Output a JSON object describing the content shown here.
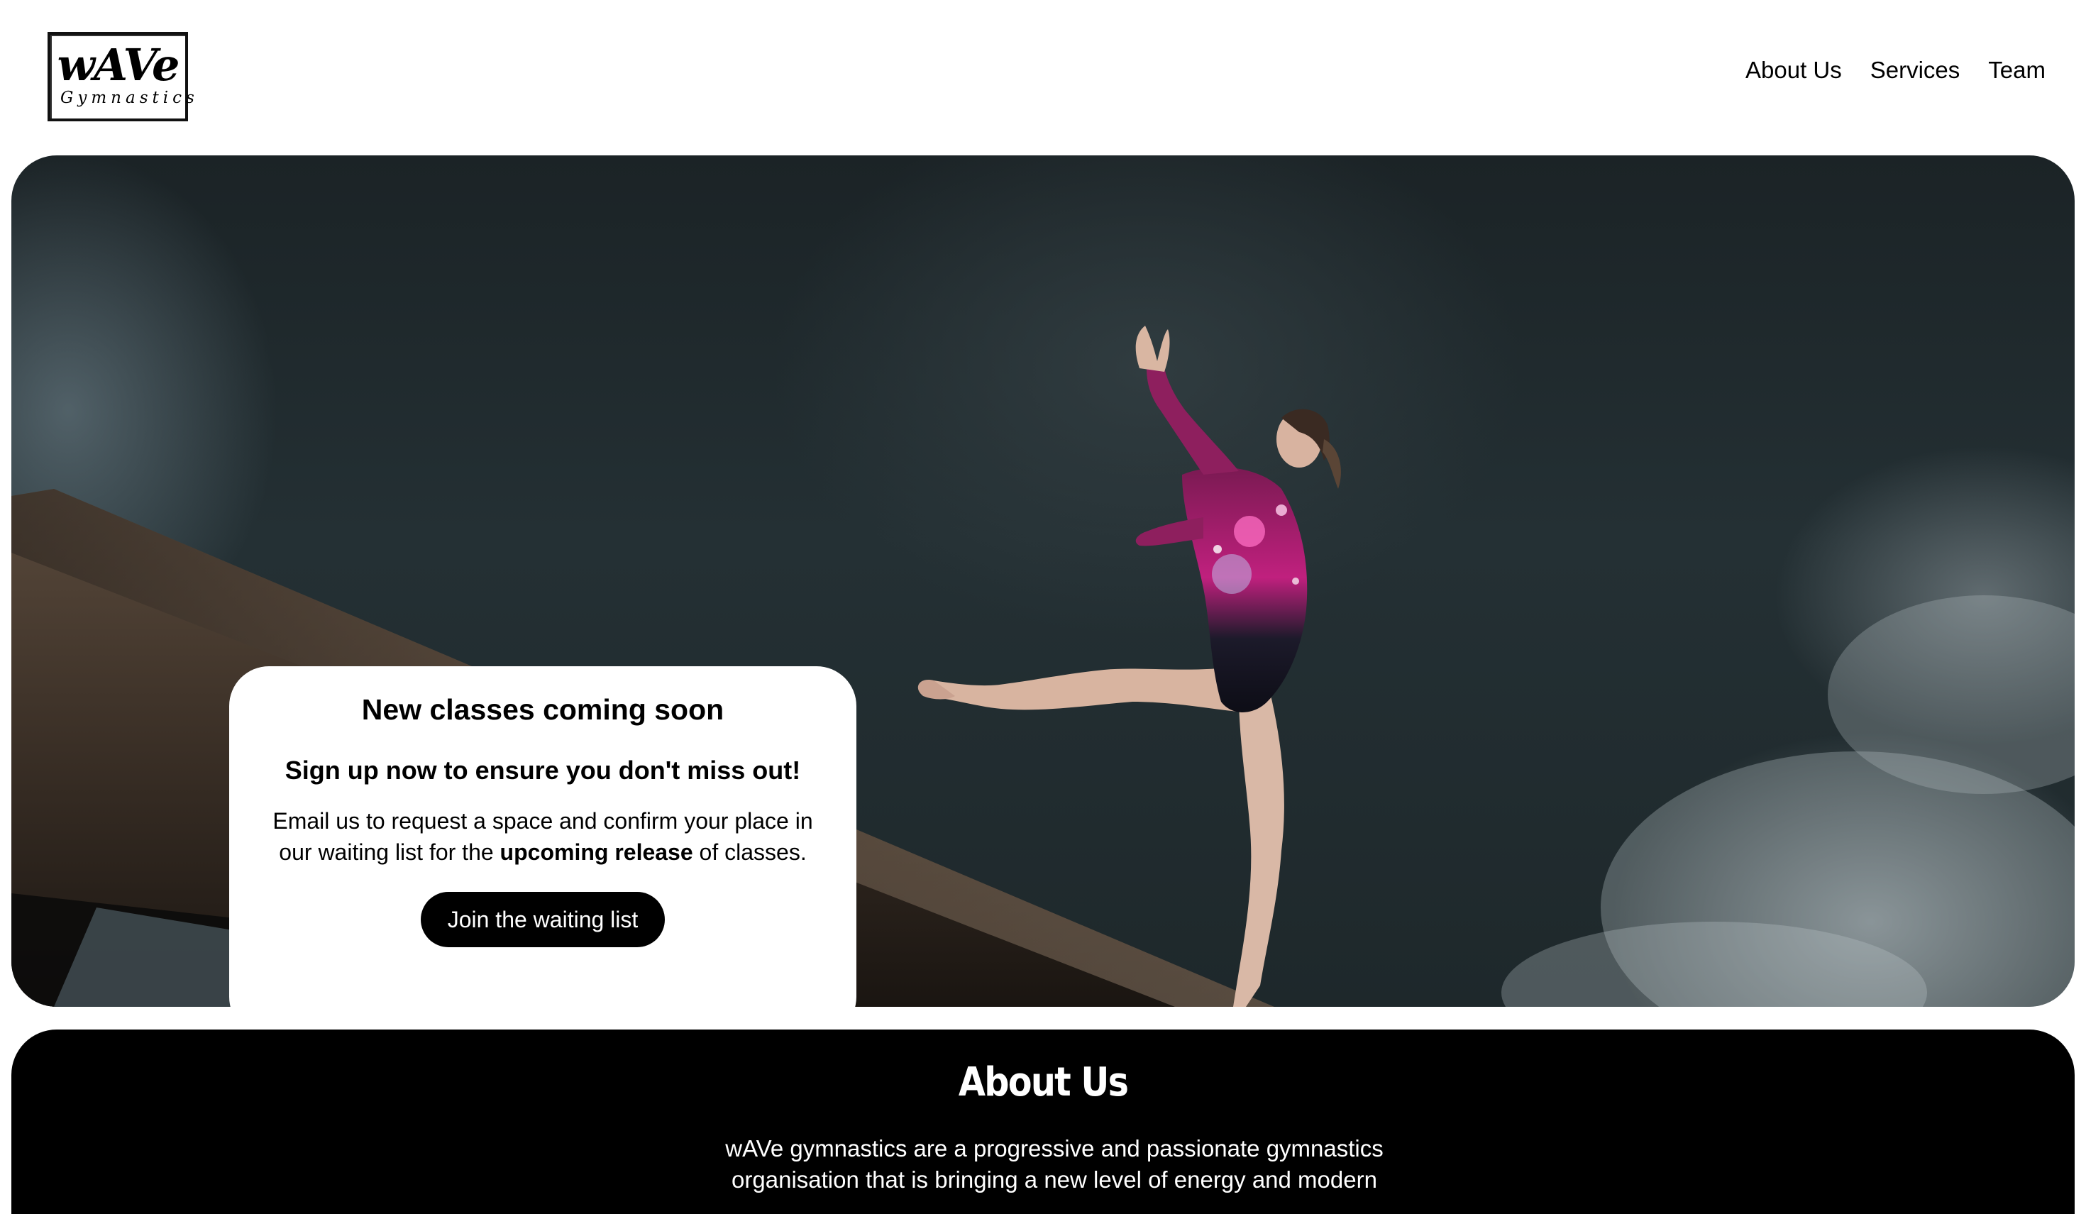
{
  "header": {
    "logo": {
      "main": "wAVe",
      "sub": "Gymnastics"
    },
    "nav": [
      {
        "label": "About Us"
      },
      {
        "label": "Services"
      },
      {
        "label": "Team"
      }
    ]
  },
  "hero": {
    "card": {
      "title": "New classes coming soon",
      "subtitle": "Sign up now to ensure you don't miss out!",
      "body_before": "Email us to request a space and confirm your place in our waiting list for the ",
      "body_bold": "upcoming release",
      "body_after": " of classes.",
      "cta_label": "Join the waiting list"
    }
  },
  "about": {
    "title": "About Us",
    "text": "wAVe gymnastics are a progressive and passionate gymnastics organisation that is bringing a new level of energy and modern"
  },
  "colors": {
    "primary": "#000000",
    "background": "#ffffff",
    "hero_dark": "#1e282b"
  }
}
